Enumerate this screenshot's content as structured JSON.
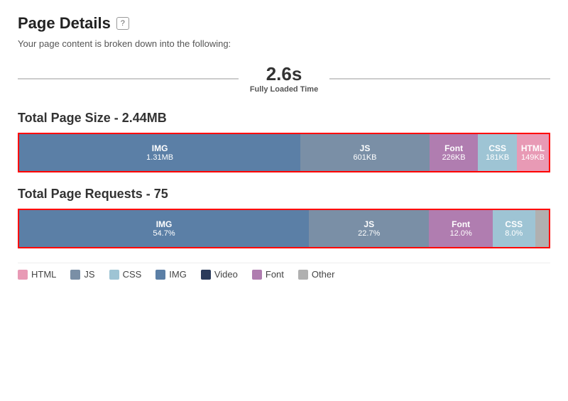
{
  "header": {
    "title": "Page Details",
    "help_label": "?",
    "subtitle": "Your page content is broken down into the following:"
  },
  "timeline": {
    "value": "2.6s",
    "description": "Fully Loaded Time"
  },
  "sections": [
    {
      "id": "page-size",
      "title": "Total Page Size - 2.44MB",
      "segments": [
        {
          "label": "IMG",
          "value": "1.31MB",
          "color": "color-img",
          "flex": 53.7
        },
        {
          "label": "JS",
          "value": "601KB",
          "color": "color-js",
          "flex": 24.6
        },
        {
          "label": "Font",
          "value": "226KB",
          "color": "color-font",
          "flex": 9.3
        },
        {
          "label": "CSS",
          "value": "181KB",
          "color": "color-css",
          "flex": 7.4
        },
        {
          "label": "HTML",
          "value": "149KB",
          "color": "color-html",
          "flex": 6.1
        }
      ]
    },
    {
      "id": "page-requests",
      "title": "Total Page Requests - 75",
      "segments": [
        {
          "label": "IMG",
          "value": "54.7%",
          "color": "color-img",
          "flex": 54.7
        },
        {
          "label": "JS",
          "value": "22.7%",
          "color": "color-js",
          "flex": 22.7
        },
        {
          "label": "Font",
          "value": "12.0%",
          "color": "color-font",
          "flex": 12.0
        },
        {
          "label": "CSS",
          "value": "8.0%",
          "color": "color-css",
          "flex": 8.0
        },
        {
          "label": "",
          "value": "",
          "color": "color-other",
          "flex": 2.6
        }
      ]
    }
  ],
  "legend": [
    {
      "id": "html",
      "label": "HTML",
      "color": "color-html"
    },
    {
      "id": "js",
      "label": "JS",
      "color": "color-js"
    },
    {
      "id": "css",
      "label": "CSS",
      "color": "color-css"
    },
    {
      "id": "img",
      "label": "IMG",
      "color": "color-img"
    },
    {
      "id": "video",
      "label": "Video",
      "color": "color-video"
    },
    {
      "id": "font",
      "label": "Font",
      "color": "color-font"
    },
    {
      "id": "other",
      "label": "Other",
      "color": "color-other"
    }
  ]
}
